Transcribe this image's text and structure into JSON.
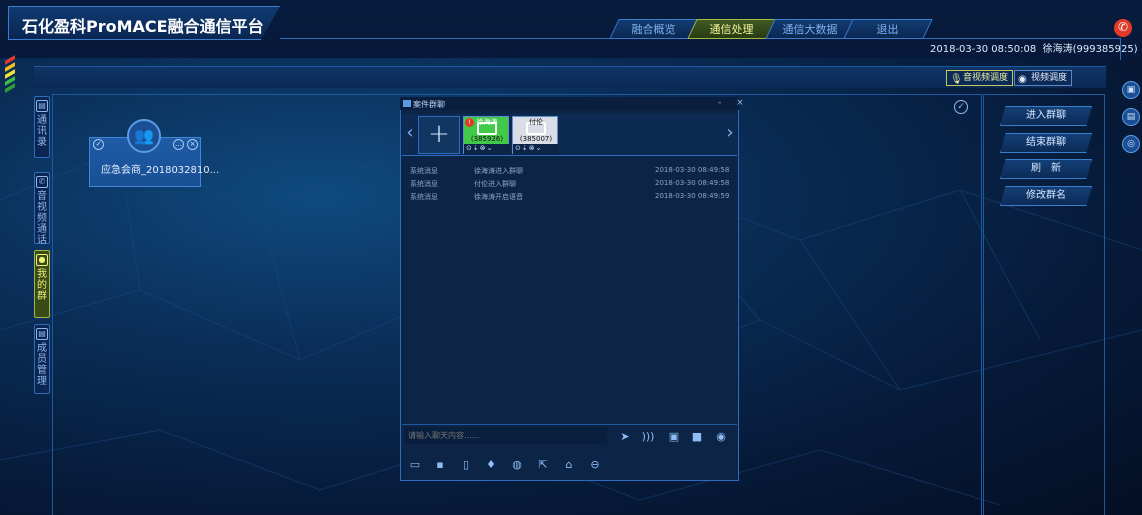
{
  "app": {
    "title": "石化盈科ProMACE融合通信平台"
  },
  "nav": {
    "tabs": [
      "融合概览",
      "通信处理",
      "通信大数据",
      "退出"
    ],
    "active": 1
  },
  "status": {
    "datetime": "2018-03-30 08:50:08",
    "user": "徐海涛(999385925)"
  },
  "dispatch": {
    "audio_label": "音视频调度",
    "video_label": "视频调度"
  },
  "left_tabs": [
    {
      "label": "通讯录",
      "icon": "contacts-icon"
    },
    {
      "label": "音视频通话",
      "icon": "phone-icon"
    },
    {
      "label": "我的群",
      "icon": "chat-icon"
    },
    {
      "label": "成员管理",
      "icon": "member-icon"
    }
  ],
  "group": {
    "name": "应急会商_2018032810..."
  },
  "chat": {
    "window_title": "案件群聊",
    "controls": "- ×",
    "members": [
      {
        "name": "徐海涛",
        "id": "(385926)",
        "color": "#43c94a"
      },
      {
        "name": "付伦",
        "id": "(385007)",
        "color": "#d8dde6"
      }
    ],
    "messages": [
      {
        "from": "系统消息",
        "text": "徐海涛进入群聊",
        "time": "2018-03-30 08:49:58"
      },
      {
        "from": "系统消息",
        "text": "付伦进入群聊",
        "time": "2018-03-30 08:49:58"
      },
      {
        "from": "系统消息",
        "text": "徐海涛开启语音",
        "time": "2018-03-30 08:49:59"
      }
    ],
    "input_placeholder": "请输入聊天内容......"
  },
  "right_actions": [
    "进入群聊",
    "结束群聊",
    "刷　新",
    "修改群名"
  ],
  "colors": {
    "accent": "#2e6dbe",
    "active_tab": "#a7b84a",
    "close": "#e23a2a"
  }
}
